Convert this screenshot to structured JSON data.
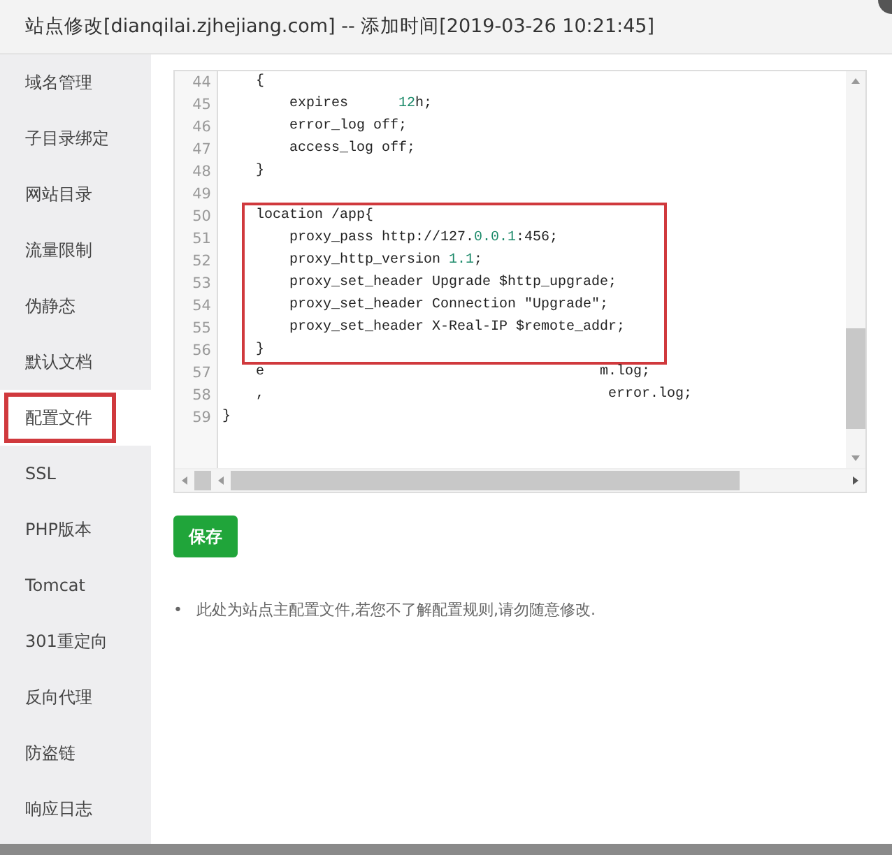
{
  "window": {
    "title": "站点修改[dianqilai.zjhejiang.com] -- 添加时间[2019-03-26 10:21:45]"
  },
  "sidebar": {
    "items": [
      {
        "label": "域名管理",
        "selected": false
      },
      {
        "label": "子目录绑定",
        "selected": false
      },
      {
        "label": "网站目录",
        "selected": false
      },
      {
        "label": "流量限制",
        "selected": false
      },
      {
        "label": "伪静态",
        "selected": false
      },
      {
        "label": "默认文档",
        "selected": false
      },
      {
        "label": "配置文件",
        "selected": true
      },
      {
        "label": "SSL",
        "selected": false
      },
      {
        "label": "PHP版本",
        "selected": false
      },
      {
        "label": "Tomcat",
        "selected": false
      },
      {
        "label": "301重定向",
        "selected": false
      },
      {
        "label": "反向代理",
        "selected": false
      },
      {
        "label": "防盗链",
        "selected": false
      },
      {
        "label": "响应日志",
        "selected": false
      }
    ]
  },
  "editor": {
    "blocks": [
      {
        "kind": "plain",
        "lines": [
          {
            "number": "44",
            "tokens": [
              {
                "text": "    {",
                "kind": "plain"
              }
            ]
          },
          {
            "number": "45",
            "tokens": [
              {
                "text": "        expires      ",
                "kind": "plain"
              },
              {
                "text": "12",
                "kind": "number"
              },
              {
                "text": "h;",
                "kind": "plain"
              }
            ]
          },
          {
            "number": "46",
            "tokens": [
              {
                "text": "        error_log off;",
                "kind": "plain"
              }
            ]
          },
          {
            "number": "47",
            "tokens": [
              {
                "text": "        access_log off;",
                "kind": "plain"
              }
            ]
          },
          {
            "number": "48",
            "tokens": [
              {
                "text": "    }",
                "kind": "plain"
              }
            ]
          },
          {
            "number": "49"
          }
        ]
      },
      {
        "kind": "highlighted",
        "lines": [
          {
            "number": "50",
            "tokens": [
              {
                "text": "    location /app{",
                "kind": "plain"
              }
            ]
          },
          {
            "number": "51",
            "tokens": [
              {
                "text": "        proxy_pass http://127.",
                "kind": "plain"
              },
              {
                "text": "0.0.1",
                "kind": "number"
              },
              {
                "text": ":456;",
                "kind": "plain"
              }
            ]
          },
          {
            "number": "52",
            "tokens": [
              {
                "text": "        proxy_http_version ",
                "kind": "plain"
              },
              {
                "text": "1.1",
                "kind": "number"
              },
              {
                "text": ";",
                "kind": "plain"
              }
            ]
          },
          {
            "number": "53",
            "tokens": [
              {
                "text": "        proxy_set_header Upgrade $http_upgrade;",
                "kind": "plain"
              }
            ]
          },
          {
            "number": "54",
            "tokens": [
              {
                "text": "        proxy_set_header Connection \"Upgrade\";",
                "kind": "plain"
              }
            ]
          },
          {
            "number": "55",
            "tokens": [
              {
                "text": "        proxy_set_header X-Real-IP $remote_addr;",
                "kind": "plain"
              }
            ]
          },
          {
            "number": "56",
            "tokens": [
              {
                "text": "    }",
                "kind": "plain"
              }
            ]
          }
        ]
      },
      {
        "kind": "plain",
        "lines": [
          {
            "number": "57",
            "tokens": [
              {
                "text": "    e                                        m.log;",
                "kind": "plain"
              }
            ]
          },
          {
            "number": "58",
            "tokens": [
              {
                "text": "    ,                                         error.log;",
                "kind": "plain"
              }
            ]
          },
          {
            "number": "59",
            "tokens": [
              {
                "text": "}",
                "kind": "plain"
              }
            ]
          }
        ]
      }
    ]
  },
  "save_button": "保存",
  "notes": [
    {
      "bullet": "•",
      "text": "此处为站点主配置文件,若您不了解配置规则,请勿随意修改."
    }
  ]
}
